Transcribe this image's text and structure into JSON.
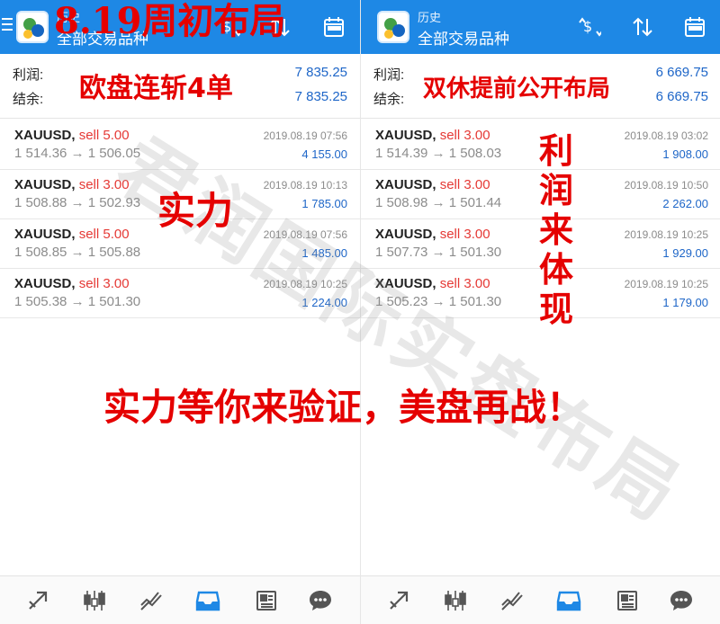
{
  "left": {
    "header": {
      "title": "历史",
      "subtitle": "全部交易品种"
    },
    "summary": {
      "profit_label": "利润:",
      "profit_value": "7 835.25",
      "balance_label": "结余:",
      "balance_value": "7 835.25"
    },
    "trades": [
      {
        "symbol": "XAUUSD,",
        "side": "sell 5.00",
        "date": "2019.08.19 07:56",
        "price_from": "1 514.36",
        "arrow": "→",
        "price_to": "1 506.05",
        "profit": "4 155.00"
      },
      {
        "symbol": "XAUUSD,",
        "side": "sell 3.00",
        "date": "2019.08.19 10:13",
        "price_from": "1 508.88",
        "arrow": "→",
        "price_to": "1 502.93",
        "profit": "1 785.00"
      },
      {
        "symbol": "XAUUSD,",
        "side": "sell 5.00",
        "date": "2019.08.19 07:56",
        "price_from": "1 508.85",
        "arrow": "→",
        "price_to": "1 505.88",
        "profit": "1 485.00"
      },
      {
        "symbol": "XAUUSD,",
        "side": "sell 3.00",
        "date": "2019.08.19 10:25",
        "price_from": "1 505.38",
        "arrow": "→",
        "price_to": "1 501.30",
        "profit": "1 224.00"
      }
    ]
  },
  "right": {
    "header": {
      "title": "历史",
      "subtitle": "全部交易品种"
    },
    "summary": {
      "profit_label": "利润:",
      "profit_value": "6 669.75",
      "balance_label": "结余:",
      "balance_value": "6 669.75"
    },
    "trades": [
      {
        "symbol": "XAUUSD,",
        "side": "sell 3.00",
        "date": "2019.08.19 03:02",
        "price_from": "1 514.39",
        "arrow": "→",
        "price_to": "1 508.03",
        "profit": "1 908.00"
      },
      {
        "symbol": "XAUUSD,",
        "side": "sell 3.00",
        "date": "2019.08.19 10:50",
        "price_from": "1 508.98",
        "arrow": "→",
        "price_to": "1 501.44",
        "profit": "2 262.00"
      },
      {
        "symbol": "XAUUSD,",
        "side": "sell 3.00",
        "date": "2019.08.19 10:25",
        "price_from": "1 507.73",
        "arrow": "→",
        "price_to": "1 501.30",
        "profit": "1 929.00"
      },
      {
        "symbol": "XAUUSD,",
        "side": "sell 3.00",
        "date": "2019.08.19 10:25",
        "price_from": "1 505.23",
        "arrow": "→",
        "price_to": "1 501.30",
        "profit": "1 179.00"
      }
    ]
  },
  "overlays": {
    "headline": "8.19周初布局",
    "left_caption": "欧盘连斩4单",
    "right_caption": "双休提前公开布局",
    "strength": "实力",
    "vertical": [
      "利",
      "润",
      "来",
      "体",
      "现"
    ],
    "bottom_slogan": "实力等你来验证，美盘再战！",
    "watermark": "君润国际实盘布局"
  },
  "icons": {
    "header_right": [
      "dollar-sort-icon",
      "sort-arrows-icon",
      "calendar-icon"
    ],
    "nav": [
      "trade-icon",
      "candlestick-chart-icon",
      "line-chart-icon",
      "history-inbox-icon",
      "news-icon",
      "chat-icon"
    ]
  },
  "colors": {
    "header": "#1e88e5",
    "sell": "#e53935",
    "profit": "#1e66c8",
    "overlay": "#e50000",
    "nav_active": "#1e88e5"
  }
}
